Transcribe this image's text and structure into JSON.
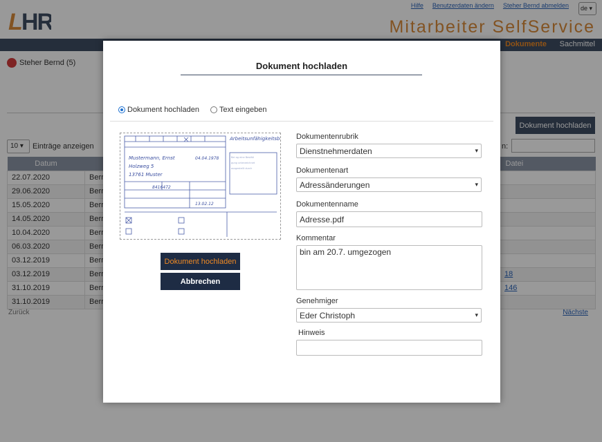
{
  "header": {
    "logo_text": "LHR",
    "links": [
      "Hilfe",
      "Benutzerdaten ändern",
      "Steher Bernd abmelden"
    ],
    "language": "de",
    "app_title": "Mitarbeiter SelfService"
  },
  "nav": {
    "active": "Dokumente",
    "other": "Sachmittel"
  },
  "user": {
    "name": "Steher Bernd (5)"
  },
  "page": {
    "upload_button": "Dokument hochladen",
    "page_length": "10",
    "page_length_label": "Einträge anzeigen",
    "search_label": "n:",
    "table": {
      "headers": [
        "Datum",
        "",
        "",
        "",
        "",
        "",
        "Datei"
      ],
      "rows": [
        [
          "22.07.2020",
          "Berr",
          ""
        ],
        [
          "29.06.2020",
          "Berr",
          ""
        ],
        [
          "15.05.2020",
          "Berr",
          ""
        ],
        [
          "14.05.2020",
          "Berr",
          ""
        ],
        [
          "10.04.2020",
          "Berr",
          ""
        ],
        [
          "06.03.2020",
          "Berr",
          ""
        ],
        [
          "03.12.2019",
          "Berr",
          ""
        ],
        [
          "03.12.2019",
          "Berr",
          "18"
        ],
        [
          "31.10.2019",
          "Berr",
          "146"
        ],
        [
          "31.10.2019",
          "Berr",
          ""
        ]
      ]
    },
    "prev": "Zurück",
    "next": "Nächste"
  },
  "modal": {
    "title": "Dokument hochladen",
    "mode_upload": "Dokument hochladen",
    "mode_text": "Text eingeben",
    "btn_upload": "Dokument hochladen",
    "btn_cancel": "Abbrechen",
    "preview_title": "Arbeitsunfähigkeitsbescheinigung",
    "fields": {
      "rubrik_label": "Dokumentenrubrik",
      "rubrik_value": "Dienstnehmerdaten",
      "art_label": "Dokumentenart",
      "art_value": "Adressänderungen",
      "name_label": "Dokumentenname",
      "name_value": "Adresse.pdf",
      "comment_label": "Kommentar",
      "comment_value": "bin am 20.7. umgezogen",
      "approver_label": "Genehmiger",
      "approver_value": "Eder Christoph",
      "hint_label": "Hinweis",
      "hint_value": ""
    }
  },
  "colors": {
    "accent_orange": "#f08a24",
    "navy": "#1e2c44",
    "nav_bg": "#3e4d63"
  }
}
